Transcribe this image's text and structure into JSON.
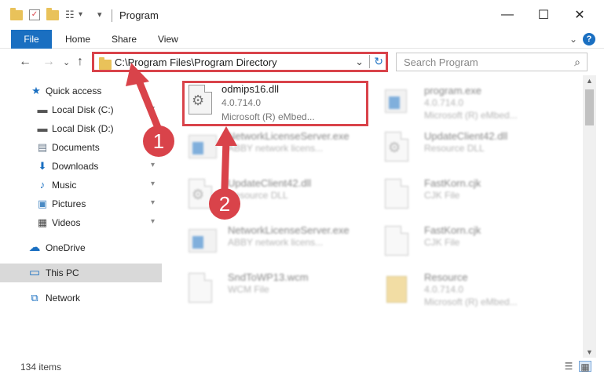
{
  "window": {
    "title": "Program",
    "controls": {
      "minimize": "—",
      "maximize": "☐",
      "close": "✕"
    }
  },
  "ribbon": {
    "tabs": [
      {
        "label": "File"
      },
      {
        "label": "Home"
      },
      {
        "label": "Share"
      },
      {
        "label": "View"
      }
    ],
    "expand_glyph": "⌄",
    "help_glyph": "?"
  },
  "nav": {
    "back": "←",
    "forward": "→",
    "recent": "⌄",
    "up": "↑",
    "address": "C:\\Program Files\\Program Directory",
    "address_chevron": "⌄",
    "refresh": "↻",
    "search_placeholder": "Search Program",
    "search_glyph": "⌕"
  },
  "sidebar": {
    "items": [
      {
        "label": "Quick access",
        "icon": "star-icon",
        "glyph": "★",
        "color": "#1a6fc1",
        "pinned": false
      },
      {
        "label": "Local Disk (C:)",
        "icon": "drive-icon",
        "glyph": "▬",
        "color": "#555555",
        "pinned": true
      },
      {
        "label": "Local Disk (D:)",
        "icon": "drive-icon",
        "glyph": "▬",
        "color": "#555555",
        "pinned": false
      },
      {
        "label": "Documents",
        "icon": "document-icon",
        "glyph": "▤",
        "color": "#6b7b8c",
        "pinned": false
      },
      {
        "label": "Downloads",
        "icon": "download-icon",
        "glyph": "⬇",
        "color": "#1a6fc1",
        "pinned": true
      },
      {
        "label": "Music",
        "icon": "music-icon",
        "glyph": "♪",
        "color": "#1a6fc1",
        "pinned": true
      },
      {
        "label": "Pictures",
        "icon": "picture-icon",
        "glyph": "▣",
        "color": "#4a8ac4",
        "pinned": true
      },
      {
        "label": "Videos",
        "icon": "video-icon",
        "glyph": "▦",
        "color": "#444444",
        "pinned": true
      },
      {
        "label": "OneDrive",
        "icon": "cloud-icon",
        "glyph": "☁",
        "color": "#1a6fc1",
        "pinned": false
      },
      {
        "label": "This PC",
        "icon": "computer-icon",
        "glyph": "▭",
        "color": "#1a6fc1",
        "pinned": false,
        "selected": true
      },
      {
        "label": "Network",
        "icon": "network-icon",
        "glyph": "⧉",
        "color": "#1a6fc1",
        "pinned": false
      }
    ],
    "pin_glyph": "📌"
  },
  "files": [
    {
      "name": "odmips16.dll",
      "line2": "4.0.714.0",
      "line3": "Microsoft (R) eMbed...",
      "kind": "dll",
      "highlight": true
    },
    {
      "name": "program.exe",
      "line2": "4.0.714.0",
      "line3": "Microsoft (R) eMbed...",
      "kind": "exe"
    },
    {
      "name": "NetworkLicenseServer.exe",
      "line2": "ABBY network licens...",
      "line3": "",
      "kind": "app"
    },
    {
      "name": "UpdateClient42.dll",
      "line2": "Resource DLL",
      "line3": "",
      "kind": "dll"
    },
    {
      "name": "UpdateClient42.dll",
      "line2": "Resource DLL",
      "line3": "",
      "kind": "dll"
    },
    {
      "name": "FastKorn.cjk",
      "line2": "CJK File",
      "line3": "",
      "kind": "doc"
    },
    {
      "name": "NetworkLicenseServer.exe",
      "line2": "ABBY network licens...",
      "line3": "",
      "kind": "app"
    },
    {
      "name": "FastKorn.cjk",
      "line2": "CJK File",
      "line3": "",
      "kind": "doc"
    },
    {
      "name": "SndToWP13.wcm",
      "line2": "WCM File",
      "line3": "",
      "kind": "doc"
    },
    {
      "name": "Resource",
      "line2": "4.0.714.0",
      "line3": "Microsoft (R) eMbed...",
      "kind": "zip"
    }
  ],
  "status": {
    "item_count": "134 items"
  },
  "annotations": {
    "badge1": "1",
    "badge2": "2",
    "color": "#d9434a"
  }
}
